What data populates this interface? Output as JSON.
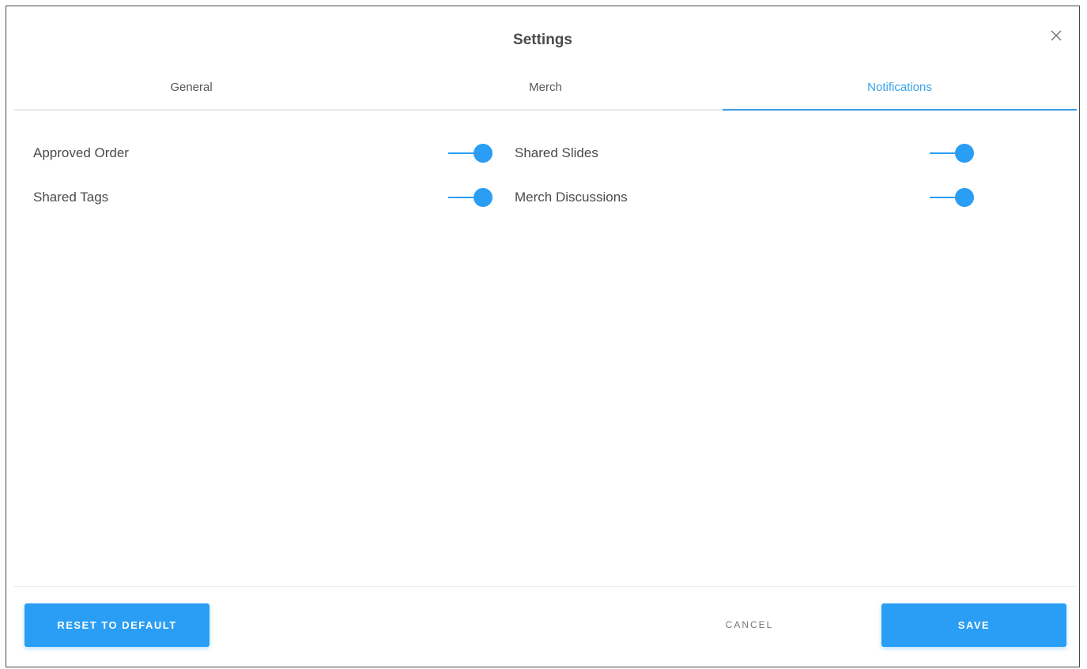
{
  "dialog": {
    "title": "Settings",
    "close_icon": "close-icon"
  },
  "tabs": [
    {
      "label": "General",
      "active": false
    },
    {
      "label": "Merch",
      "active": false
    },
    {
      "label": "Notifications",
      "active": true
    }
  ],
  "settings": [
    {
      "label": "Approved Order",
      "enabled": true
    },
    {
      "label": "Shared Slides",
      "enabled": true
    },
    {
      "label": "Shared Tags",
      "enabled": true
    },
    {
      "label": "Merch Discussions",
      "enabled": true
    }
  ],
  "footer": {
    "reset_label": "RESET TO DEFAULT",
    "cancel_label": "CANCEL",
    "save_label": "SAVE"
  },
  "colors": {
    "accent": "#2a9df4",
    "tab_active": "#3aa0e8",
    "text": "#4a4a4a"
  }
}
